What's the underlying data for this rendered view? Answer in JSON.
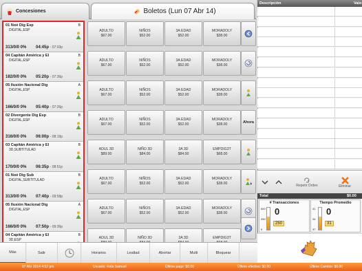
{
  "tabs": {
    "concessions": "Concesiones",
    "tickets": "Boletos (Lun 07 Abr 14)"
  },
  "movies": [
    {
      "title": "01 Noé Dig Esp",
      "format": "DIGITAL,ESP",
      "letter": "B",
      "count": "313/0/0 0%",
      "time": "04:45p",
      "time_end": "07:03p"
    },
    {
      "title": "04 Capitán América y El",
      "format": "DIGITAL,ESP",
      "letter": "B",
      "count": "182/0/0 0%",
      "time": "05:20p",
      "time_end": "07:36p"
    },
    {
      "title": "05 Ilusión Nacional Dig",
      "format": "DIGITAL,ESP",
      "letter": "A",
      "count": "166/0/0 0%",
      "time": "05:40p",
      "time_end": "07:26p"
    },
    {
      "title": "02 Divergente Dig Esp",
      "format": "DIGITAL,ESP",
      "letter": "B",
      "count": "316/0/0 0%",
      "time": "06:00p",
      "time_end": "08:19p"
    },
    {
      "title": "03 Capitán América y El",
      "format": "3D,SUBTITULAD",
      "letter": "B",
      "count": "170/0/0 0%",
      "time": "06:35p",
      "time_end": "08:51p"
    },
    {
      "title": "01 Noé Dig Sub",
      "format": "DIGITAL,SUBTITULAD",
      "letter": "B",
      "count": "313/0/0 0%",
      "time": "07:40p",
      "time_end": "09:58p"
    },
    {
      "title": "05 Ilusión Nacional Dig",
      "format": "DIGITAL,ESP",
      "letter": "A",
      "count": "166/0/0 0%",
      "time": "07:50p",
      "time_end": "09:36p"
    },
    {
      "title": "04 Capitán América y El",
      "format": "3D,ESP",
      "letter": "B",
      "count": "182/0/0 0%",
      "time": "08:15p",
      "time_end": "10:31p"
    }
  ],
  "price_rows": [
    [
      {
        "l1": "ADULTO",
        "l2": "$67.00"
      },
      {
        "l1": "NIÑOS",
        "l2": "$52.00"
      },
      {
        "l1": "3A EDAD",
        "l2": "$52.00"
      },
      {
        "l1": "MORADOLY",
        "l2": "$38.00"
      }
    ],
    [
      {
        "l1": "ADULTO",
        "l2": "$67.00"
      },
      {
        "l1": "NIÑOS",
        "l2": "$52.00"
      },
      {
        "l1": "3A EDAD",
        "l2": "$52.00"
      },
      {
        "l1": "MORADOLY",
        "l2": "$38.00"
      }
    ],
    [
      {
        "l1": "ADULTO",
        "l2": "$67.00"
      },
      {
        "l1": "NIÑOS",
        "l2": "$52.00"
      },
      {
        "l1": "3A EDAD",
        "l2": "$52.00"
      },
      {
        "l1": "MORADOLY",
        "l2": "$38.00"
      }
    ],
    [
      {
        "l1": "ADULTO",
        "l2": "$67.00"
      },
      {
        "l1": "NIÑOS",
        "l2": "$52.00"
      },
      {
        "l1": "3A EDAD",
        "l2": "$52.00"
      },
      {
        "l1": "MORADOLY",
        "l2": "$38.00"
      }
    ],
    [
      {
        "l1": "ADUL 3D",
        "l2": "$89.00"
      },
      {
        "l1": "NIÑO 3D",
        "l2": "$84.00"
      },
      {
        "l1": "3A 3D",
        "l2": "$84.00"
      },
      {
        "l1": "EMPDIG3T",
        "l2": "$68.00"
      }
    ],
    [
      {
        "l1": "ADULTO",
        "l2": "$67.00"
      },
      {
        "l1": "NIÑOS",
        "l2": "$52.00"
      },
      {
        "l1": "3A EDAD",
        "l2": "$52.00"
      },
      {
        "l1": "MORADOLY",
        "l2": "$38.00"
      }
    ],
    [
      {
        "l1": "ADULTO",
        "l2": "$67.00"
      },
      {
        "l1": "NIÑOS",
        "l2": "$52.00"
      },
      {
        "l1": "3A EDAD",
        "l2": "$52.00"
      },
      {
        "l1": "MORADOLY",
        "l2": "$38.00"
      }
    ],
    [
      {
        "l1": "ADUL 3D",
        "l2": "$89.00"
      },
      {
        "l1": "NIÑO 3D",
        "l2": "$84.00"
      },
      {
        "l1": "3A 3D",
        "l2": "$84.00"
      },
      {
        "l1": "EMPDIG3T",
        "l2": "$68.00"
      }
    ]
  ],
  "side_buttons": {
    "ahora": "Ahora"
  },
  "desc_header": {
    "description": "Descripción",
    "value": "Valo"
  },
  "actions": {
    "repeat_order": "Repetir Orden",
    "delete": "Eliminar"
  },
  "total": {
    "label": "Total",
    "value": "$0.00"
  },
  "stats": {
    "transactions": {
      "title": "# Transacciones",
      "value": "0",
      "chip": "250",
      "tick_top": "500",
      "tick_mid": "250",
      "tick_bottom": "0"
    },
    "avg_time": {
      "title": "Tiempo Promedio",
      "value": "0",
      "chip": "31",
      "tick_top": "31",
      "tick_mid": "26",
      "tick_bottom": "37"
    }
  },
  "nav": [
    "Más",
    "Salir",
    "",
    "Horarios",
    "Lealtad",
    "Abortar",
    "Multi",
    "Bloquear"
  ],
  "status": {
    "datetime": "07 Abr 2014 4:52 pm",
    "user": "Usuario: Rela Samuel",
    "last_payment": "Último pago: $0.00",
    "last_paid_change": "Último efectivo: $0.00",
    "last_change": "Último Cambio: $0.00"
  },
  "colors": {
    "accent": "#e0242b",
    "status": "#f07a2a"
  }
}
